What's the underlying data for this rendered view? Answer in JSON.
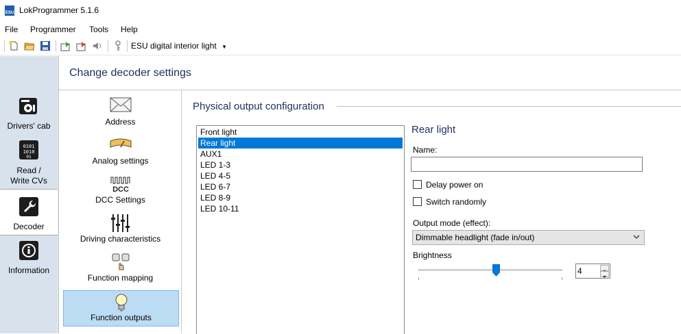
{
  "window": {
    "title": "LokProgrammer 5.1.6",
    "icon_name": "esu-app-icon",
    "icon_text": "ESU"
  },
  "menu": {
    "items": [
      "File",
      "Programmer",
      "Tools",
      "Help"
    ]
  },
  "toolbar": {
    "buttons": [
      "new-file-icon",
      "open-folder-icon",
      "save-icon",
      "read-decoder-icon",
      "write-decoder-icon",
      "play-sound-icon",
      "key-icon"
    ],
    "device_label": "ESU digital interior light"
  },
  "leftnav": {
    "items": [
      {
        "id": "drivers-cab",
        "label": "Drivers' cab",
        "icon": "drivers-cab-icon"
      },
      {
        "id": "read-write",
        "label": "Read / Write CVs",
        "icon": "read-write-cvs-icon"
      },
      {
        "id": "decoder",
        "label": "Decoder",
        "icon": "wrench-icon",
        "selected": true
      },
      {
        "id": "information",
        "label": "Information",
        "icon": "info-icon"
      }
    ]
  },
  "header": {
    "title": "Change decoder settings"
  },
  "settings": {
    "items": [
      {
        "label": "Address",
        "icon": "envelope-icon"
      },
      {
        "label": "Analog settings",
        "icon": "analog-meter-icon"
      },
      {
        "label": "DCC Settings",
        "icon": "dcc-icon"
      },
      {
        "label": "Driving characteristics",
        "icon": "sliders-icon"
      },
      {
        "label": "Function mapping",
        "icon": "function-mapping-icon"
      },
      {
        "label": "Function outputs",
        "icon": "lightbulb-icon",
        "selected": true
      }
    ],
    "dcc_icon_text": "DCC"
  },
  "section": {
    "title": "Physical output configuration"
  },
  "outputs": {
    "items": [
      "Front light",
      "Rear light",
      "AUX1",
      "LED 1-3",
      "LED 4-5",
      "LED 6-7",
      "LED 8-9",
      "LED 10-11"
    ],
    "selected_index": 1
  },
  "detail": {
    "title": "Rear light",
    "name_label": "Name:",
    "name_value": "",
    "delay_power_on": {
      "label": "Delay power on",
      "checked": false
    },
    "switch_randomly": {
      "label": "Switch randomly",
      "checked": false
    },
    "output_mode_label": "Output mode (effect):",
    "output_mode_value": "Dimmable headlight (fade in/out)",
    "brightness_label": "Brightness",
    "brightness_value": "4",
    "brightness_fraction": 0.54
  },
  "colors": {
    "accent": "#0078d7",
    "heading": "#1b2f5c",
    "selected_tile": "#bcdcf4",
    "nav_bg": "#d8e2ec"
  }
}
